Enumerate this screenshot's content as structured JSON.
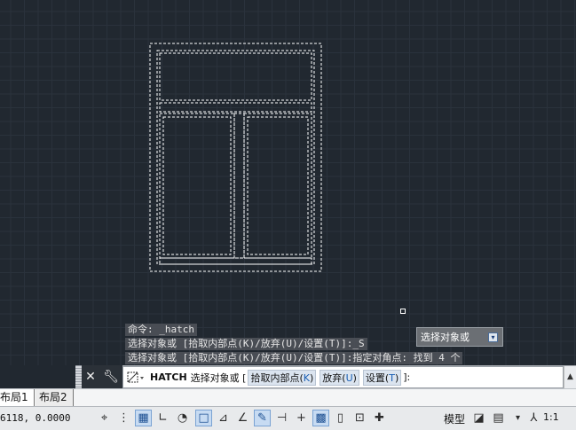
{
  "history": {
    "line1": "命令: _hatch",
    "line2": "选择对象或 [拾取内部点(K)/放弃(U)/设置(T)]:_S",
    "line3": "选择对象或 [拾取内部点(K)/放弃(U)/设置(T)]:指定对角点: 找到 4 个"
  },
  "tooltip": {
    "label": "选择对象或"
  },
  "command_line": {
    "command": "HATCH",
    "prompt": "选择对象或 [",
    "opt1_text": "拾取内部点(",
    "opt1_key": "K",
    "opt1_close": ")",
    "opt2_text": "放弃(",
    "opt2_key": "U",
    "opt2_close": ")",
    "opt3_text": "设置(",
    "opt3_key": "T",
    "opt3_close": ")",
    "suffix": "]:"
  },
  "tabs": {
    "layout1": "布局1",
    "layout2": "布局2"
  },
  "status": {
    "coords": "6118, 0.0000",
    "model": "模型",
    "scale": "1:1"
  },
  "colors": {
    "canvas_bg": "#212830",
    "selection_line": "#ffffff",
    "toggle_on": "#c7dbf2"
  },
  "icons": [
    "close-icon",
    "wrench-icon",
    "hatch-command-icon",
    "snap-icon",
    "grid-icon",
    "ortho-icon",
    "polar-icon",
    "osnap-icon",
    "otrack-icon",
    "ducs-icon",
    "dyn-icon",
    "lineweight-icon",
    "transparency-icon",
    "selection-cycling-icon",
    "annotation-monitor-icon",
    "plus-icon",
    "model-space-icon",
    "annotation-scale-icon"
  ]
}
